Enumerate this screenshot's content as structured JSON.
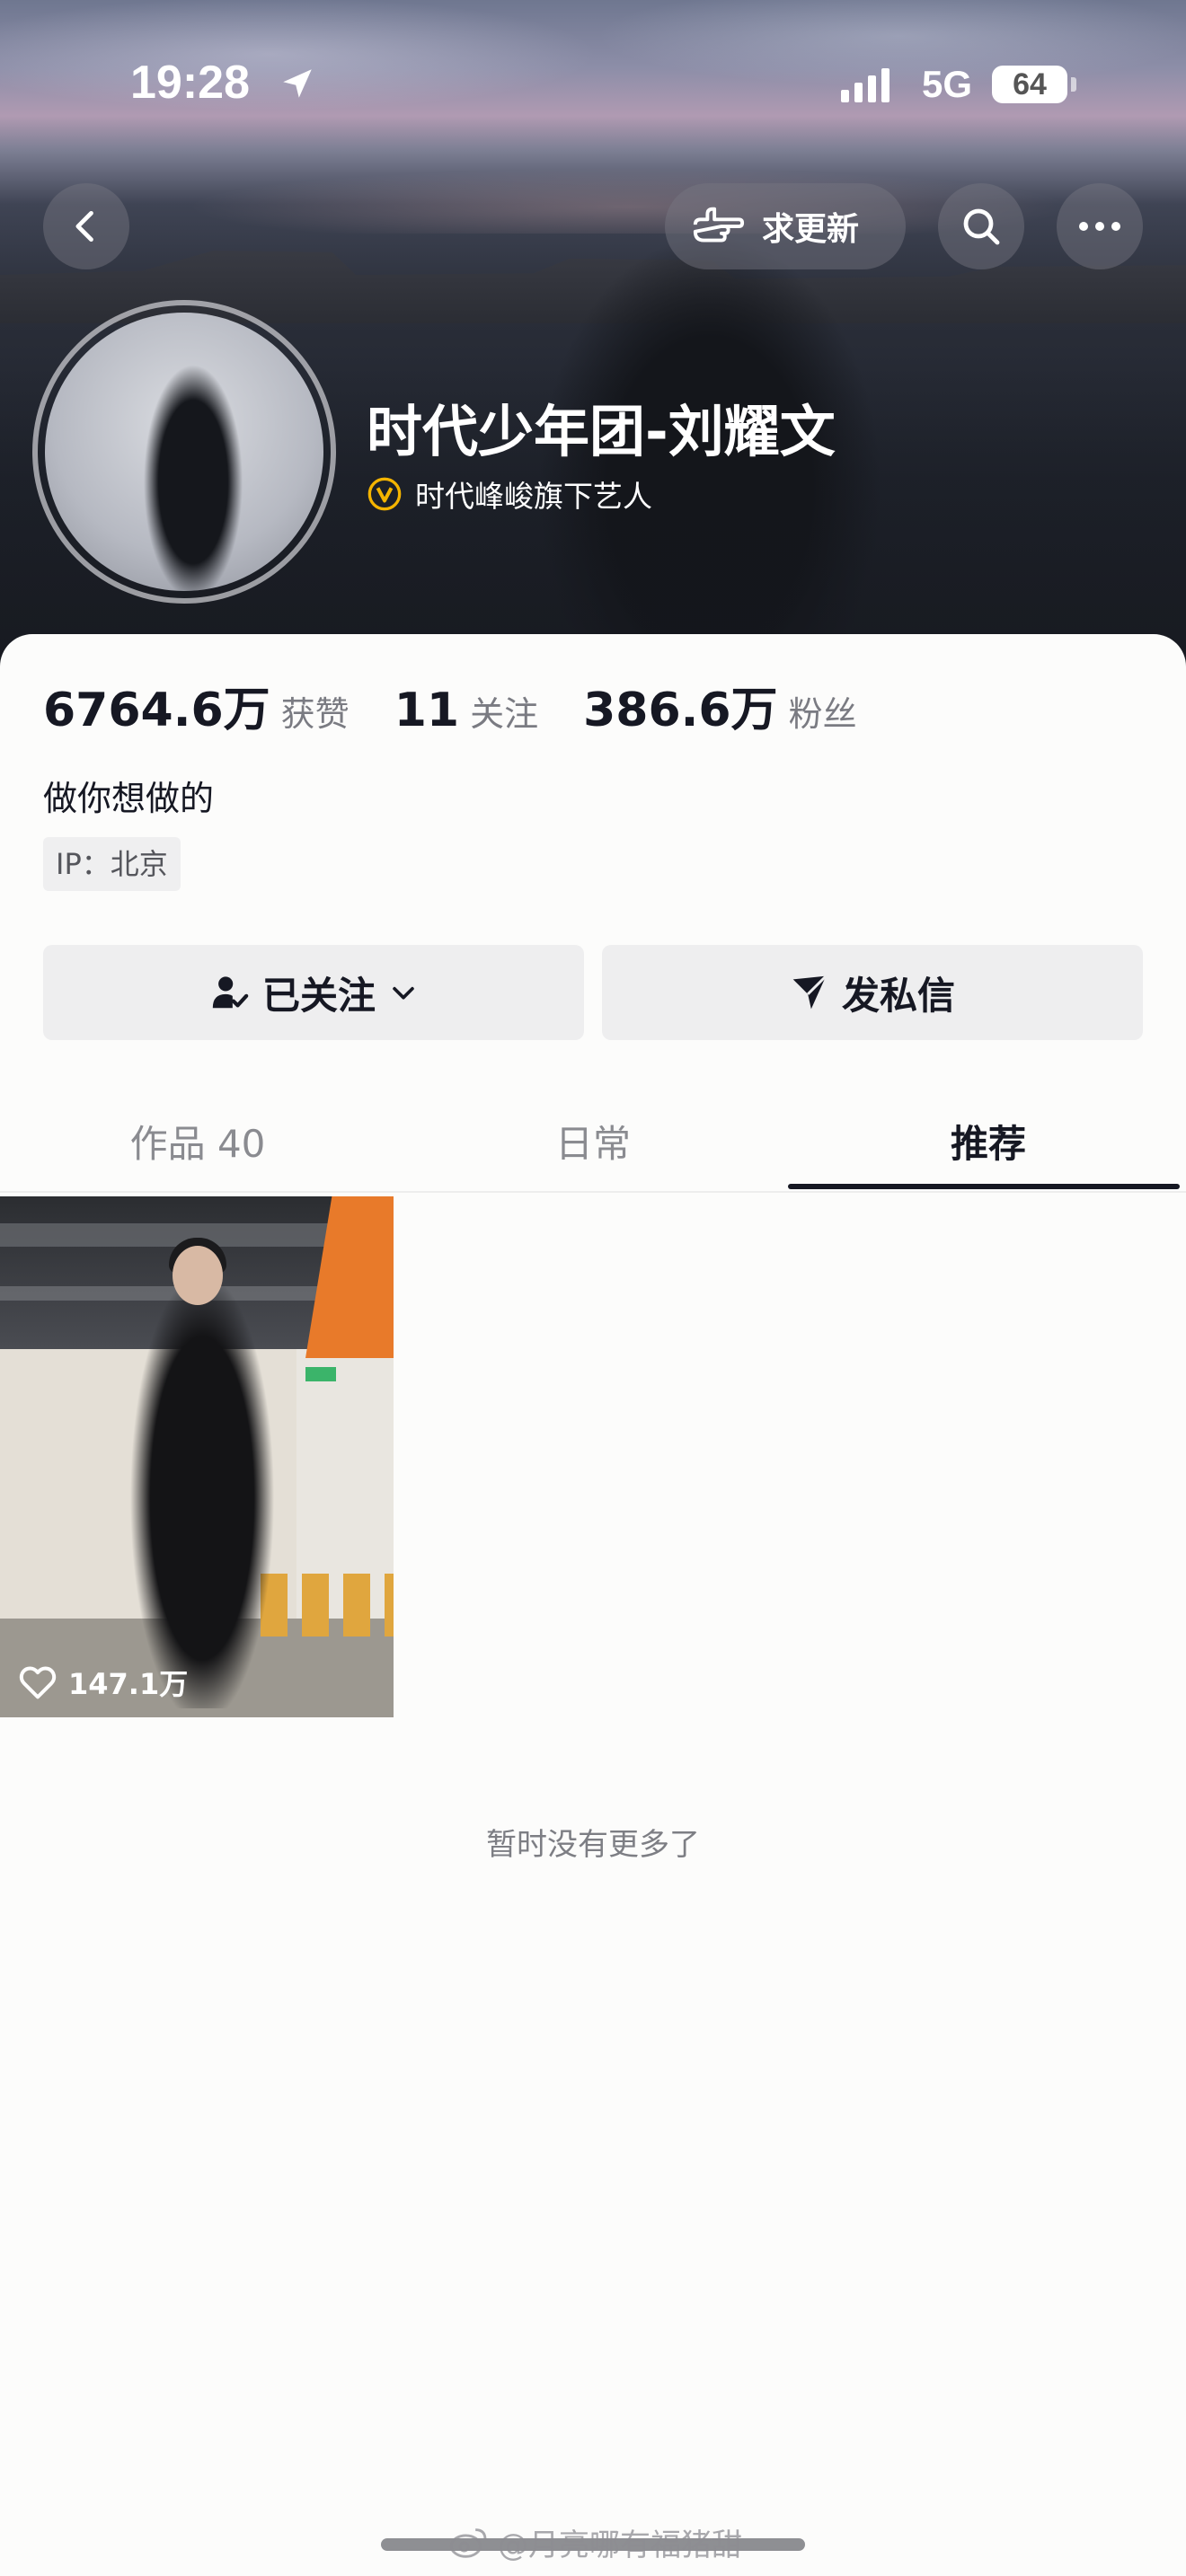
{
  "status_bar": {
    "time": "19:28",
    "network": "5G",
    "battery": "64"
  },
  "nav": {
    "request_update_label": "求更新"
  },
  "profile": {
    "nickname": "时代少年团-刘耀文",
    "verified_text": "时代峰峻旗下艺人",
    "stats": [
      {
        "value": "6764.6万",
        "label": "获赞"
      },
      {
        "value": "11",
        "label": "关注"
      },
      {
        "value": "386.6万",
        "label": "粉丝"
      }
    ],
    "bio": "做你想做的",
    "ip": "IP：北京"
  },
  "actions": {
    "follow_label": "已关注",
    "message_label": "发私信"
  },
  "tabs": [
    {
      "label": "作品 40",
      "active": false
    },
    {
      "label": "日常",
      "active": false
    },
    {
      "label": "推荐",
      "active": true
    }
  ],
  "videos": [
    {
      "likes": "147.1万"
    }
  ],
  "end_text": "暂时没有更多了",
  "watermark": "@月亮哪有福猪甜",
  "colors": {
    "accent_verify": "#f4b400",
    "text_primary": "#161823",
    "text_secondary": "#7a7b82"
  }
}
